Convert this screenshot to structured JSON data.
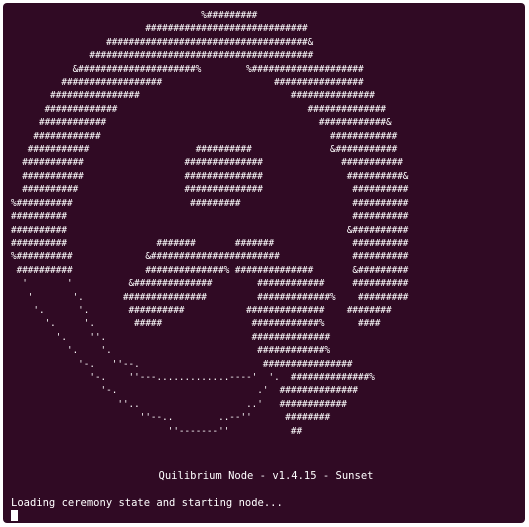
{
  "terminal": {
    "background_color": "#300a24",
    "text_color": "#ffffff",
    "ascii_logo": "                                  %#########\n                        #############################\n                 ####################################&\n              ########################################\n           &#####################%        %####################\n         ##################                    ################\n       ################                           ###############\n      #############                                  ##############\n     ############                                      ############&\n    ############                                         ############\n   ###########                   ##########              &###########\n  ###########                  ##############              ###########\n  ###########                  ##############               ##########&\n  ##########                   ##############                ##########\n%##########                     #########                    ##########\n##########                                                   ##########\n##########                                                  &##########\n##########                #######       #######              ##########\n%##########             &#######################             ##########\n ##########             ##############% ##############       &#########\n  '       '          &##############        ############     ##########\n   '       '.       ###############         #############%    #########\n    '.      '.       ##########           ##############    ########\n      '.     '.       #####                ############%      ####\n        '.    ''.                          ##############\n          '.    '.                          ############%\n            '-.   ''--.                      ################\n              '-.    ''---.............----'  '.  ##############%\n                '-.                         .'  ##############\n                   ''..                   ..'   ############\n                       ''--..        ..--''      ########\n                            ''-------''           ##\n",
    "banner": "Quilibrium Node - v1.4.15 - Sunset",
    "status": "Loading ceremony state and starting node..."
  }
}
